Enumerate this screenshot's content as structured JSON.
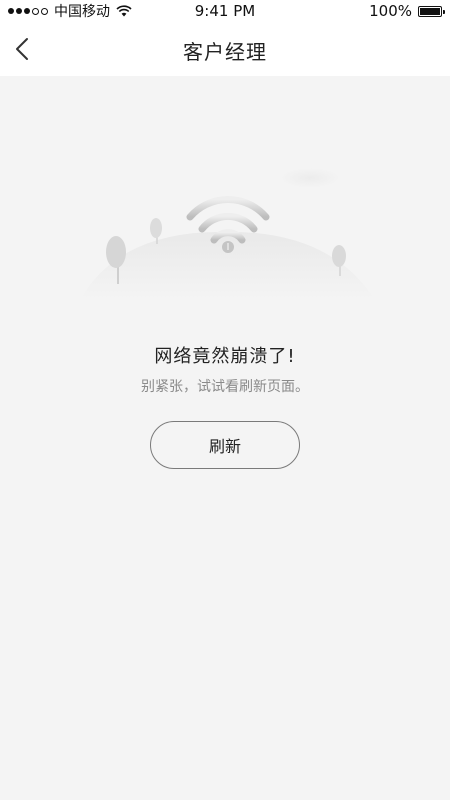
{
  "status_bar": {
    "carrier": "中国移动",
    "signal_bars_filled": 3,
    "signal_bars_total": 5,
    "time": "9:41 PM",
    "battery_text": "100%",
    "battery_level": 1.0
  },
  "nav": {
    "title": "客户经理",
    "back_icon": "chevron-left-icon"
  },
  "error": {
    "illustration_icon": "wifi-icon",
    "title": "网络竟然崩溃了!",
    "subtitle": "别紧张，试试看刷新页面。",
    "refresh_label": "刷新"
  },
  "colors": {
    "background": "#f4f4f4",
    "bar_background": "#ffffff",
    "primary_text": "#222222",
    "secondary_text": "#8a8a8a",
    "button_border": "#7a7a7a"
  }
}
